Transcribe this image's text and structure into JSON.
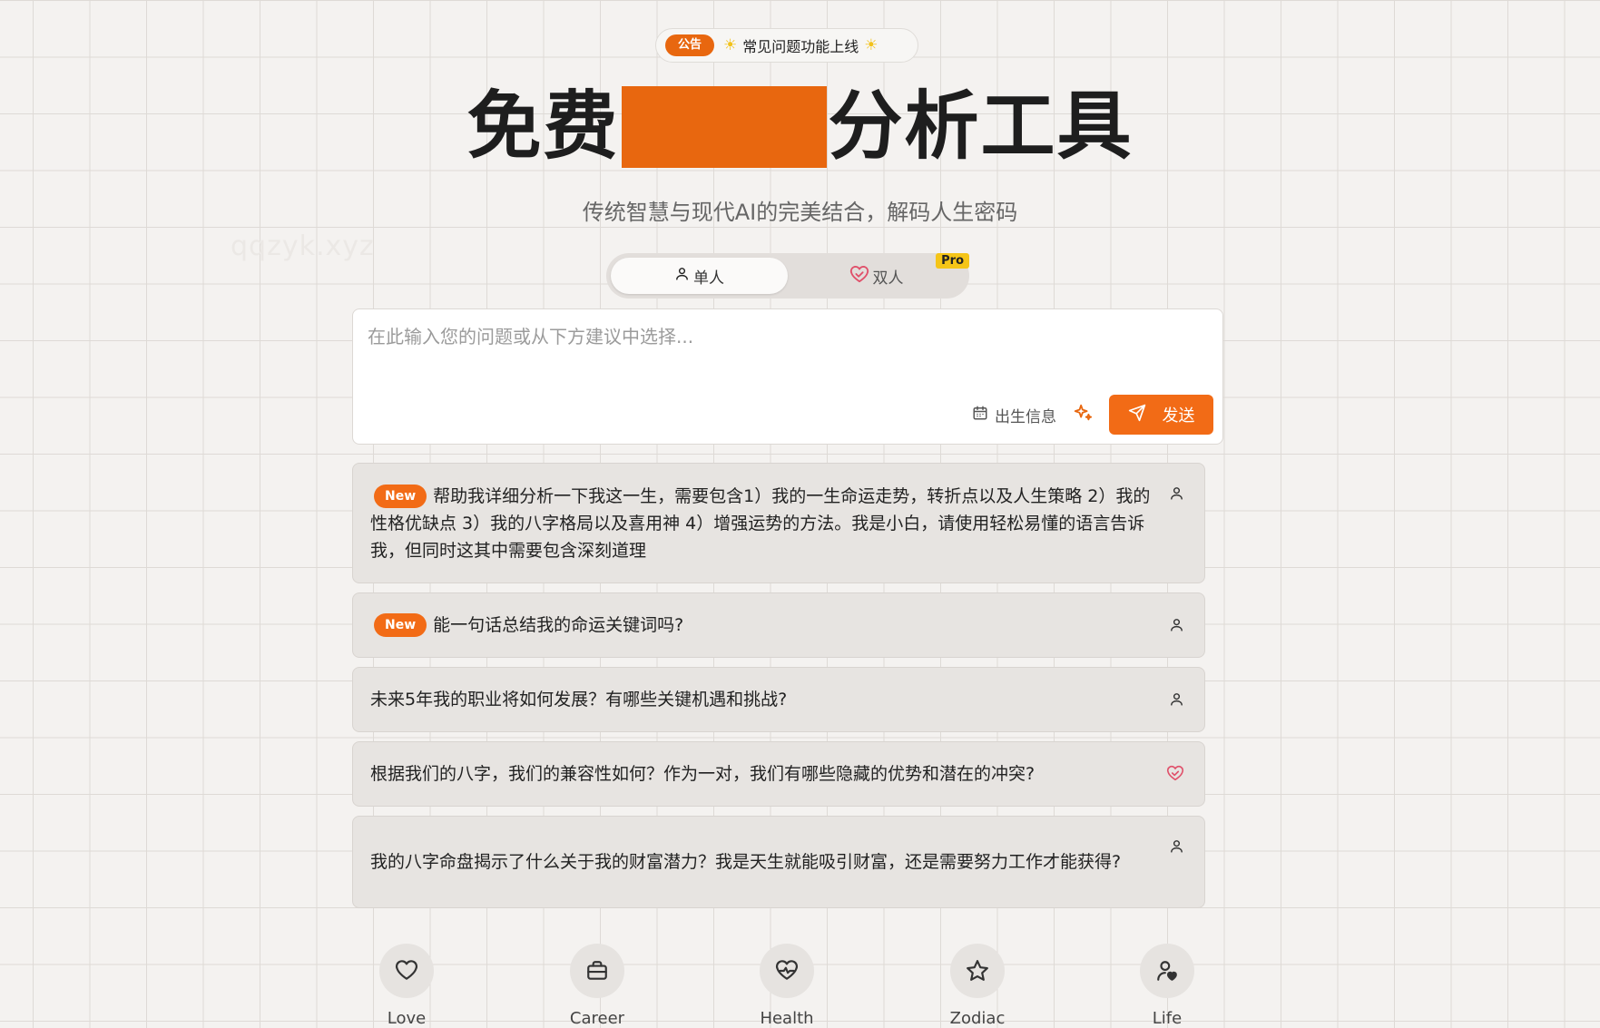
{
  "announcement": {
    "badge": "公告",
    "text": "常见问题功能上线"
  },
  "hero": {
    "title_left": "免费",
    "title_right": "分析工具",
    "subtitle": "传统智慧与现代AI的完美结合，解码人生密码",
    "watermark": "qqzyk.xyz"
  },
  "mode": {
    "single_label": "单人",
    "double_label": "双人",
    "pro_badge": "Pro",
    "active": "single"
  },
  "input": {
    "placeholder": "在此输入您的问题或从下方建议中选择...",
    "value": "",
    "birth_label": "出生信息",
    "send_label": "发送"
  },
  "suggestions": [
    {
      "badge": "New",
      "text": "帮助我详细分析一下我这一生，需要包含1）我的一生命运走势，转折点以及人生策略 2）我的性格优缺点 3）我的八字格局以及喜用神 4）增强运势的方法。我是小白，请使用轻松易懂的语言告诉我，但同时这其中需要包含深刻道理",
      "icon": "user-icon"
    },
    {
      "badge": "New",
      "text": "能一句话总结我的命运关键词吗?",
      "icon": "user-icon"
    },
    {
      "badge": "",
      "text": "未来5年我的职业将如何发展？有哪些关键机遇和挑战?",
      "icon": "user-icon"
    },
    {
      "badge": "",
      "text": "根据我们的八字，我们的兼容性如何？作为一对，我们有哪些隐藏的优势和潜在的冲突?",
      "icon": "heart-handshake-icon"
    },
    {
      "badge": "",
      "text": "我的八字命盘揭示了什么关于我的财富潜力？我是天生就能吸引财富，还是需要努力工作才能获得?",
      "icon": "user-icon"
    }
  ],
  "categories": [
    {
      "label": "Love",
      "icon": "heart-icon"
    },
    {
      "label": "Career",
      "icon": "briefcase-icon"
    },
    {
      "label": "Health",
      "icon": "heart-pulse-icon"
    },
    {
      "label": "Zodiac",
      "icon": "star-icon"
    },
    {
      "label": "Life",
      "icon": "user-heart-icon"
    }
  ],
  "colors": {
    "accent": "#f26b16",
    "redaction": "#e8670f",
    "pro": "#f5c518",
    "couple_icon": "#e0506a"
  }
}
